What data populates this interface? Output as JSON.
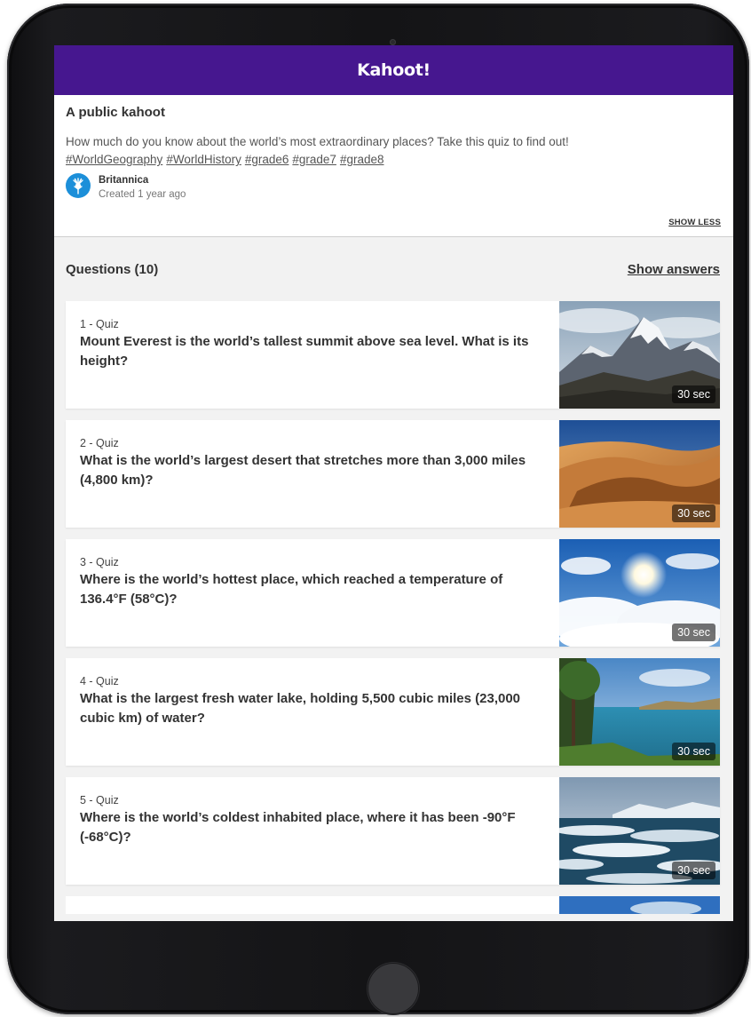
{
  "app": {
    "logo": "Kahoot!"
  },
  "kahoot": {
    "heading": "A public kahoot",
    "description": "How much do you know about the world’s most extraordinary places? Take this quiz to find out!",
    "tags": [
      "#WorldGeography",
      "#WorldHistory",
      "#grade6",
      "#grade7",
      "#grade8"
    ],
    "creator_name": "Britannica",
    "created": "Created 1 year ago",
    "show_less_label": "SHOW LESS"
  },
  "questions_section": {
    "title": "Questions (10)",
    "show_answers_label": "Show answers"
  },
  "questions": [
    {
      "number_label": "1 - Quiz",
      "text": "Mount Everest is the world’s tallest summit above sea level. What is its height?",
      "time": "30 sec",
      "image_icon": "mountain-photo"
    },
    {
      "number_label": "2 - Quiz",
      "text": "What is the world’s largest desert that stretches more than 3,000 miles (4,800 km)?",
      "time": "30 sec",
      "image_icon": "desert-photo"
    },
    {
      "number_label": "3 - Quiz",
      "text": "Where is the world’s hottest place, which reached a temperature of 136.4°F (58°C)?",
      "time": "30 sec",
      "image_icon": "sky-sun-photo"
    },
    {
      "number_label": "4 - Quiz",
      "text": "What is the largest fresh water lake, holding 5,500 cubic miles (23,000 cubic km) of water?",
      "time": "30 sec",
      "image_icon": "lake-photo"
    },
    {
      "number_label": "5 - Quiz",
      "text": "Where is the world’s coldest inhabited place, where it has been -90°F (-68°C)?",
      "time": "30 sec",
      "image_icon": "icy-sea-photo"
    }
  ],
  "colors": {
    "brand": "#46178f",
    "avatar": "#1c8fd9"
  }
}
